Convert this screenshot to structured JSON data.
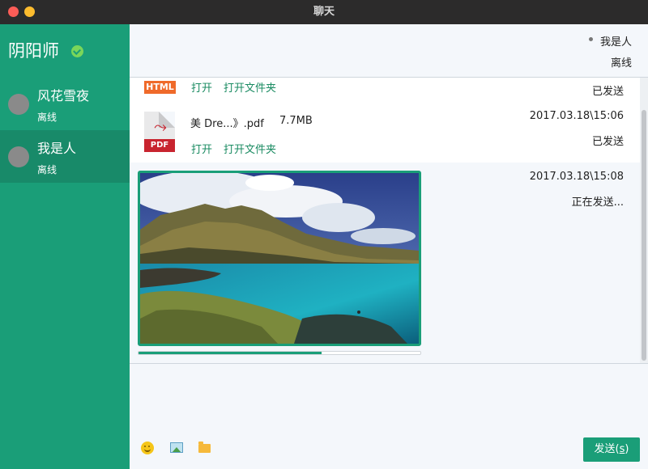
{
  "window": {
    "title": "聊天"
  },
  "sidebar": {
    "self_name": "阴阳师",
    "contacts": [
      {
        "name": "风花雪夜",
        "status": "离线"
      },
      {
        "name": "我是人",
        "status": "离线",
        "active": true
      }
    ]
  },
  "header": {
    "name": "我是人",
    "status": "离线"
  },
  "messages": [
    {
      "file_type_icon": "HTML",
      "open_label": "打开",
      "open_folder_label": "打开文件夹",
      "state": "已发送"
    },
    {
      "file_type_icon": "PDF",
      "file_name": "美 Dre...》.pdf",
      "file_size": "7.7MB",
      "open_label": "打开",
      "open_folder_label": "打开文件夹",
      "time": "2017.03.18\\15:06",
      "state": "已发送"
    },
    {
      "kind": "image",
      "time": "2017.03.18\\15:08",
      "state": "正在发送...",
      "progress": 0.65
    }
  ],
  "composer": {
    "icons": [
      "emoji-icon",
      "image-icon",
      "folder-icon"
    ],
    "send_label": "发送(",
    "send_shortcut": "s",
    "send_label_end": ")"
  },
  "colors": {
    "accent": "#1a9e78",
    "link": "#1a8b62"
  }
}
